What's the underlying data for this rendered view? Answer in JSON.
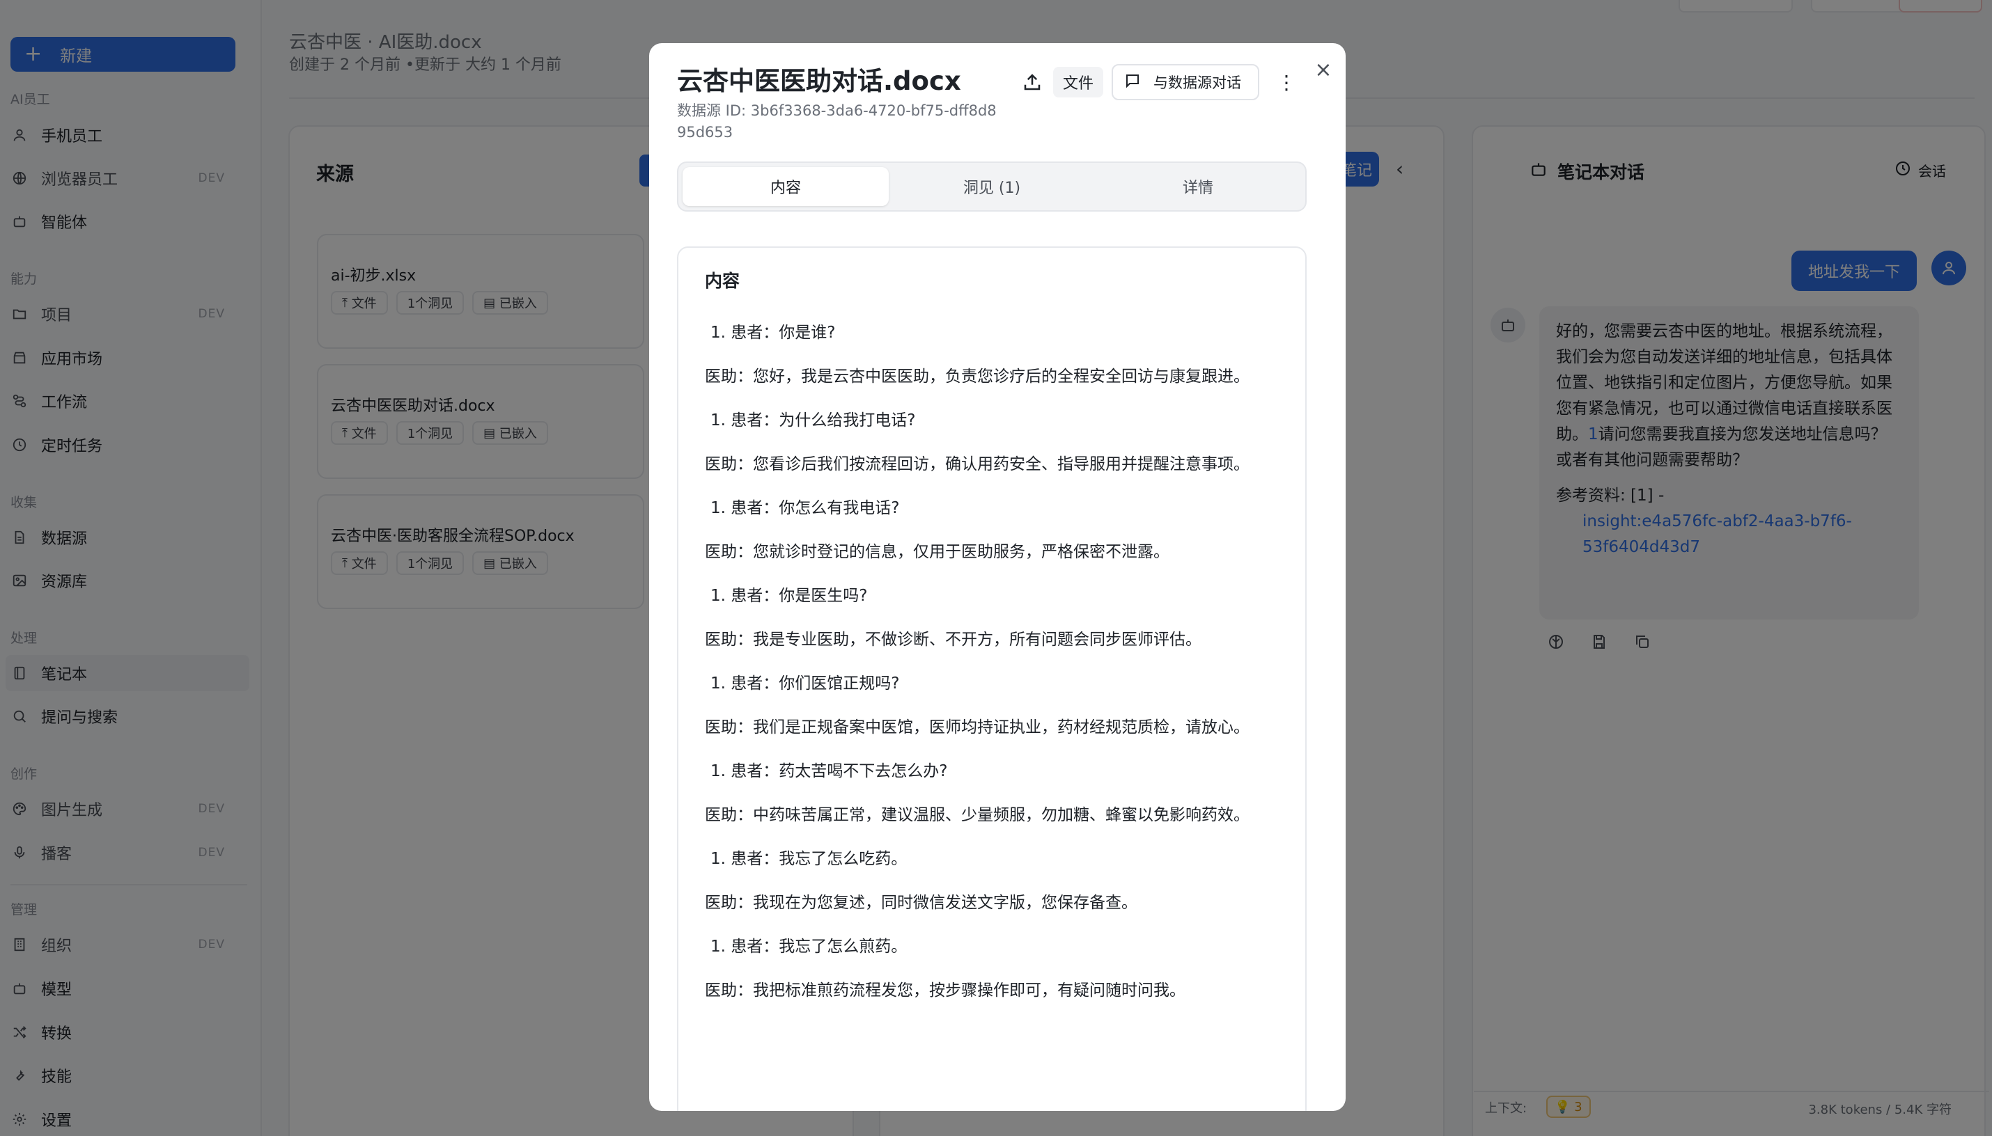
{
  "sidebar": {
    "new_label": "新建",
    "sections": {
      "ai": "AI员工",
      "capability": "能力",
      "collect": "收集",
      "process": "处理",
      "create": "创作",
      "manage": "管理"
    },
    "items": [
      {
        "label": "手机员工",
        "icon": "user-icon",
        "dev": ""
      },
      {
        "label": "浏览器员工",
        "icon": "globe-icon",
        "dev": "DEV"
      },
      {
        "label": "智能体",
        "icon": "bot-icon",
        "dev": ""
      },
      {
        "label": "项目",
        "icon": "folder-icon",
        "dev": "DEV"
      },
      {
        "label": "应用市场",
        "icon": "store-icon",
        "dev": ""
      },
      {
        "label": "工作流",
        "icon": "workflow-icon",
        "dev": ""
      },
      {
        "label": "定时任务",
        "icon": "clock-icon",
        "dev": ""
      },
      {
        "label": "数据源",
        "icon": "file-icon",
        "dev": ""
      },
      {
        "label": "资源库",
        "icon": "image-icon",
        "dev": ""
      },
      {
        "label": "笔记本",
        "icon": "notebook-icon",
        "dev": ""
      },
      {
        "label": "提问与搜索",
        "icon": "search-icon",
        "dev": ""
      },
      {
        "label": "图片生成",
        "icon": "palette-icon",
        "dev": "DEV"
      },
      {
        "label": "播客",
        "icon": "mic-icon",
        "dev": "DEV"
      },
      {
        "label": "组织",
        "icon": "building-icon",
        "dev": "DEV"
      },
      {
        "label": "模型",
        "icon": "bot-icon",
        "dev": ""
      },
      {
        "label": "转换",
        "icon": "shuffle-icon",
        "dev": ""
      },
      {
        "label": "技能",
        "icon": "wrench-icon",
        "dev": ""
      },
      {
        "label": "设置",
        "icon": "gear-icon",
        "dev": ""
      }
    ]
  },
  "background": {
    "breadcrumb": "云杏中医 · AI医助.docx",
    "meta": "创建于 2 个月前 •更新于 大约 1 个月前",
    "sources_title": "来源",
    "sources": [
      {
        "name": "ai-初步.xlsx",
        "tags": [
          "文件",
          "1个洞见",
          "已嵌入"
        ]
      },
      {
        "name": "云杏中医医助对话.docx",
        "tags": [
          "文件",
          "1个洞见",
          "已嵌入"
        ]
      },
      {
        "name": "云杏中医·医助客服全流程SOP.docx",
        "tags": [
          "文件",
          "1个洞见",
          "已嵌入"
        ]
      }
    ],
    "note_btn": "笔记",
    "chat": {
      "title": "笔记本对话",
      "session": "会话",
      "user_msg": "地址发我一下",
      "bot_msg": "好的，您需要云杏中医的地址。根据系统流程，我们会为您自动发送详细的地址信息，包括具体位置、地铁指引和定位图片，方便您导航。如果您有紧急情况，也可以通过微信电话直接联系医助。",
      "bot_link_num": "1",
      "bot_msg_tail": "请问您需要我直接为您发送地址信息吗？或者有其他问题需要帮助？",
      "ref_label": "参考资料: [1] -",
      "ref_link": "insight:e4a576fc-abf2-4aa3-b7f6-53f6404d43d7",
      "ctx_label": "上下文:",
      "ctx_count": "3",
      "tokens": "3.8K tokens / 5.4K 字符"
    }
  },
  "modal": {
    "title": "云杏中医医助对话.docx",
    "id_text": "数据源 ID: 3b6f3368-3da6-4720-bf75-dff8d895d653",
    "file_label": "文件",
    "chat_btn": "与数据源对话",
    "tabs": [
      "内容",
      "洞见 (1)",
      "详情"
    ],
    "content_heading": "内容",
    "qa": [
      {
        "q": "1. 患者：你是谁?",
        "a": "医助：您好，我是云杏中医医助，负责您诊疗后的全程安全回访与康复跟进。"
      },
      {
        "q": "1. 患者：为什么给我打电话?",
        "a": "医助：您看诊后我们按流程回访，确认用药安全、指导服用并提醒注意事项。"
      },
      {
        "q": "1. 患者：你怎么有我电话?",
        "a": "医助：您就诊时登记的信息，仅用于医助服务，严格保密不泄露。"
      },
      {
        "q": "1. 患者：你是医生吗?",
        "a": "医助：我是专业医助，不做诊断、不开方，所有问题会同步医师评估。"
      },
      {
        "q": "1. 患者：你们医馆正规吗?",
        "a": "医助：我们是正规备案中医馆，医师均持证执业，药材经规范质检，请放心。"
      },
      {
        "q": "1. 患者：药太苦喝不下去怎么办?",
        "a": "医助：中药味苦属正常，建议温服、少量频服，勿加糖、蜂蜜以免影响药效。"
      },
      {
        "q": "1. 患者：我忘了怎么吃药。",
        "a": "医助：我现在为您复述，同时微信发送文字版，您保存备查。"
      },
      {
        "q": "1. 患者：我忘了怎么煎药。",
        "a": "医助：我把标准煎药流程发您，按步骤操作即可，有疑问随时问我。"
      }
    ]
  }
}
